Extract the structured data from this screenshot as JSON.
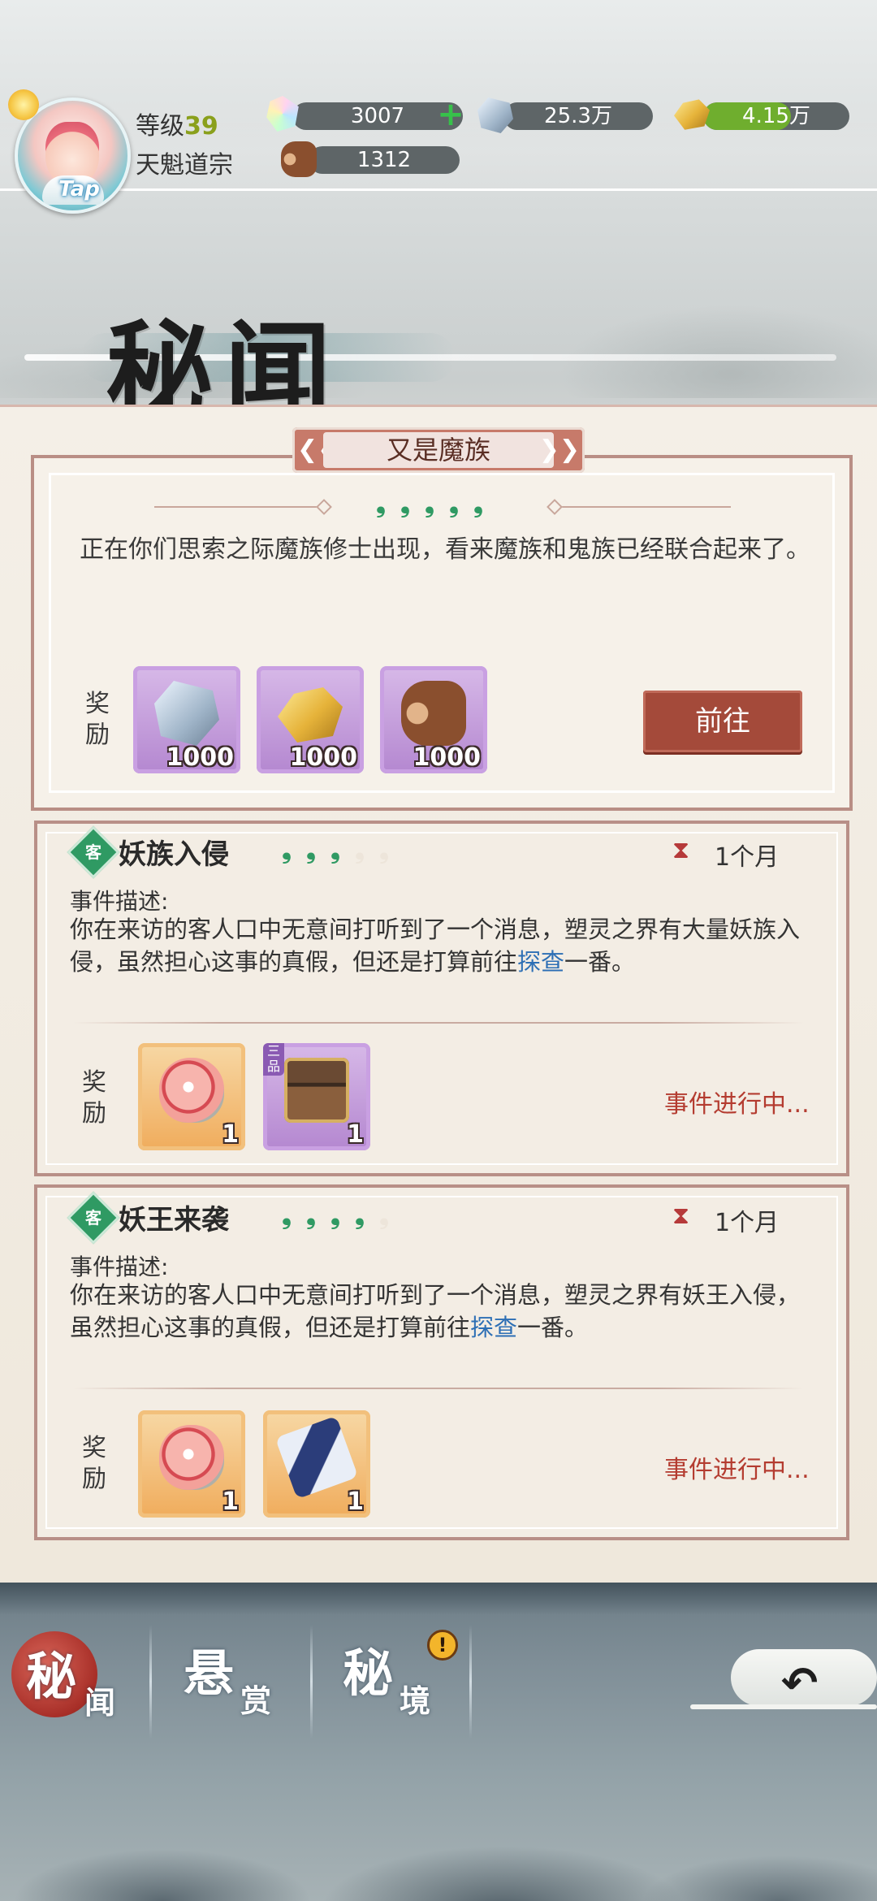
{
  "player": {
    "level_label": "等级",
    "level": "39",
    "sect": "天魁道宗",
    "tap_label": "Tap"
  },
  "resources": {
    "crystal": "3007",
    "spirit_stone": "25.3万",
    "gold": "4.15万",
    "gold_fill_fraction": 0.6,
    "wood": "1312"
  },
  "header": {
    "title": "秘闻"
  },
  "featured": {
    "title": "又是魔族",
    "stars_filled": 5,
    "stars_total": 5,
    "description": "正在你们思索之际魔族修士出现，看来魔族和鬼族已经联合起来了。",
    "reward_label": "奖励",
    "rewards": [
      {
        "icon": "spirit-stone-icon",
        "count": "1000"
      },
      {
        "icon": "gold-ore-icon",
        "count": "1000"
      },
      {
        "icon": "wood-log-icon",
        "count": "1000"
      }
    ],
    "go_button": "前往"
  },
  "events": [
    {
      "badge": "客",
      "title": "妖族入侵",
      "stars_filled": 3,
      "stars_total": 5,
      "duration": "1个月",
      "desc_label": "事件描述:",
      "desc_before": "你在来访的客人口中无意间打听到了一个消息，塑灵之界有大量妖族入侵，虽然担心这事的真假，但还是打算前往",
      "desc_link": "探查",
      "desc_after": "一番。",
      "reward_label": "奖励",
      "rewards": [
        {
          "icon": "spirit-egg-icon",
          "count": "1"
        },
        {
          "icon": "treasure-chest-icon",
          "count": "1",
          "grade": "三品"
        }
      ],
      "status": "事件进行中..."
    },
    {
      "badge": "客",
      "title": "妖王来袭",
      "stars_filled": 4,
      "stars_total": 5,
      "duration": "1个月",
      "desc_label": "事件描述:",
      "desc_before": "你在来访的客人口中无意间打听到了一个消息，塑灵之界有妖王入侵，虽然担心这事的真假，但还是打算前往",
      "desc_link": "探查",
      "desc_after": "一番。",
      "reward_label": "奖励",
      "rewards": [
        {
          "icon": "spirit-egg-icon",
          "count": "1"
        },
        {
          "icon": "scroll-icon",
          "count": "1"
        }
      ],
      "status": "事件进行中..."
    }
  ],
  "nav": {
    "tab1_big": "秘",
    "tab1_small": "闻",
    "tab2_big": "悬",
    "tab2_small": "赏",
    "tab3_big": "秘",
    "tab3_small": "境",
    "alert": "!"
  },
  "colors": {
    "accent_red": "#a44a3a",
    "star_green": "#2f9a63",
    "status_red": "#b43c30",
    "link_blue": "#2d6fb5"
  }
}
